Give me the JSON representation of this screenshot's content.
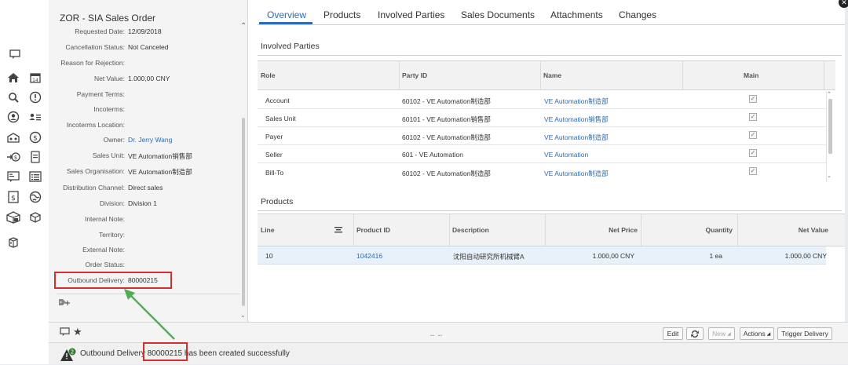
{
  "left_panel": {
    "title": "ZOR - SIA Sales Order",
    "fields": [
      {
        "label": "Requested Date:",
        "value": "12/09/2018",
        "link": false
      },
      {
        "label": "Cancellation Status:",
        "value": "Not Canceled",
        "link": false
      },
      {
        "label": "Reason for Rejection:",
        "value": "",
        "link": false
      },
      {
        "label": "Net Value:",
        "value": "1.000,00 CNY",
        "link": false
      },
      {
        "label": "Payment Terms:",
        "value": "",
        "link": false
      },
      {
        "label": "Incoterms:",
        "value": "",
        "link": false
      },
      {
        "label": "Incoterms Location:",
        "value": "",
        "link": false
      },
      {
        "label": "Owner:",
        "value": "Dr. Jerry Wang",
        "link": true
      },
      {
        "label": "Sales Unit:",
        "value": "VE Automation销售部",
        "link": false
      },
      {
        "label": "Sales Organisation:",
        "value": "VE Automation制造部",
        "link": false
      },
      {
        "label": "Distribution Channel:",
        "value": "Direct sales",
        "link": false
      },
      {
        "label": "Division:",
        "value": "Division 1",
        "link": false
      },
      {
        "label": "Internal Note:",
        "value": "",
        "link": false
      },
      {
        "label": "Territory:",
        "value": "",
        "link": false
      },
      {
        "label": "External Note:",
        "value": "",
        "link": false
      },
      {
        "label": "Order Status:",
        "value": "",
        "link": false
      },
      {
        "label": "Outbound Delivery:",
        "value": "80000215",
        "link": false
      }
    ]
  },
  "tabs": [
    "Overview",
    "Products",
    "Involved Parties",
    "Sales Documents",
    "Attachments",
    "Changes"
  ],
  "active_tab": "Overview",
  "involved_parties": {
    "title": "Involved Parties",
    "columns": [
      "Role",
      "Party ID",
      "Name",
      "Main"
    ],
    "rows": [
      {
        "role": "Account",
        "party_id": "60102 - VE Automation制造部",
        "name": "VE Automation制造部",
        "main": true
      },
      {
        "role": "Sales Unit",
        "party_id": "60101 - VE Automation销售部",
        "name": "VE Automation销售部",
        "main": true
      },
      {
        "role": "Payer",
        "party_id": "60102 - VE Automation制造部",
        "name": "VE Automation制造部",
        "main": true
      },
      {
        "role": "Seller",
        "party_id": "601 - VE Automation",
        "name": "VE Automation",
        "main": true
      },
      {
        "role": "Bill-To",
        "party_id": "60102 - VE Automation制造部",
        "name": "VE Automation制造部",
        "main": true
      }
    ]
  },
  "products": {
    "title": "Products",
    "columns": [
      "Line",
      "Product ID",
      "Description",
      "Net Price",
      "Quantity",
      "Net Value"
    ],
    "rows": [
      {
        "line": "10",
        "product_id": "1042416",
        "description": "沈阳自动研究所机械臂A",
        "net_price": "1.000,00  CNY",
        "quantity": "1  ea",
        "net_value": "1.000,00  CNY"
      }
    ]
  },
  "toolbar": {
    "edit": "Edit",
    "new": "New",
    "actions": "Actions",
    "trigger": "Trigger Delivery"
  },
  "message": {
    "prefix": "Outbound Delivery ",
    "number": "80000215",
    "suffix": " has been created successfully",
    "badge": "2"
  },
  "colors": {
    "accent": "#2a6cb5",
    "annotation_box": "#d32f2f",
    "annotation_arrow": "#4caf50"
  }
}
